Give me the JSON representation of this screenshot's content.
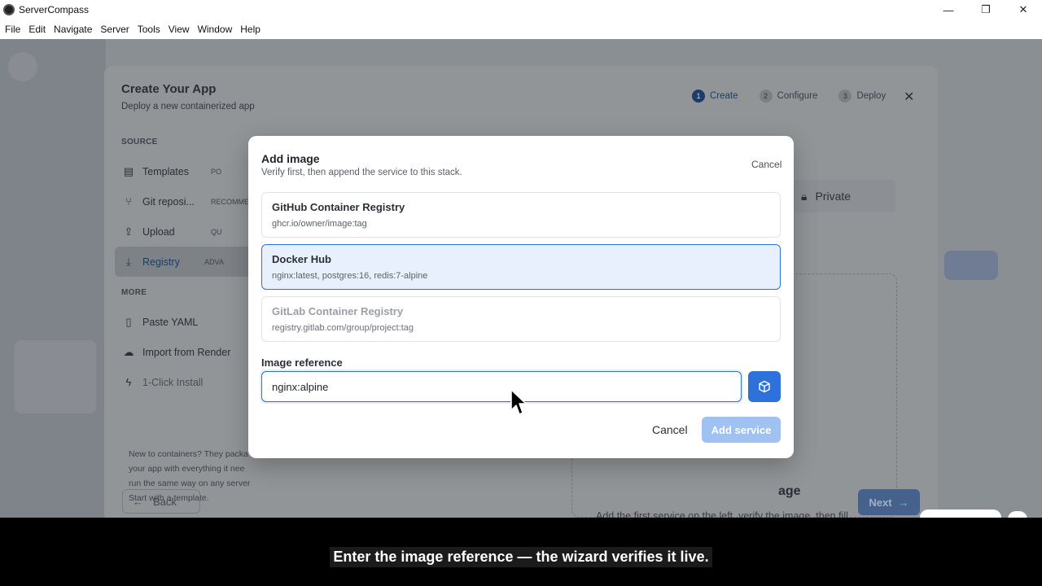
{
  "window": {
    "title": "ServerCompass",
    "minimize": "—",
    "restore": "❐",
    "close": "✕"
  },
  "menu": [
    "File",
    "Edit",
    "Navigate",
    "Server",
    "Tools",
    "View",
    "Window",
    "Help"
  ],
  "wizard": {
    "title": "Create Your App",
    "subtitle": "Deploy a new containerized app",
    "steps": [
      {
        "num": "1",
        "label": "Create"
      },
      {
        "num": "2",
        "label": "Configure"
      },
      {
        "num": "3",
        "label": "Deploy"
      }
    ],
    "close": "✕",
    "source_heading": "SOURCE",
    "source_items": [
      {
        "label": "Templates",
        "badge": "PO",
        "icon": "templates-icon"
      },
      {
        "label": "Git reposi...",
        "badge": "RECOMME",
        "icon": "git-icon"
      },
      {
        "label": "Upload",
        "badge": "QU",
        "icon": "upload-icon"
      },
      {
        "label": "Registry",
        "badge": "ADVA",
        "icon": "registry-icon"
      }
    ],
    "more_heading": "MORE",
    "more_items": [
      {
        "label": "Paste YAML",
        "icon": "document-icon"
      },
      {
        "label": "Import from Render",
        "icon": "cloud-icon"
      },
      {
        "label": "1-Click Install",
        "icon": "bolt-icon"
      }
    ],
    "help_text": [
      "New to containers? They packa",
      "your app with everything it nee",
      "run the same way on any server",
      "Start with a template."
    ],
    "back": "Back",
    "next": "Next",
    "private": "Private",
    "empty_title": "age",
    "empty_desc": "Add the first service on the left, verify the image, then fill"
  },
  "dialog": {
    "title": "Add image",
    "subtitle": "Verify first, then append the service to this stack.",
    "cancel_top": "Cancel",
    "registries": [
      {
        "name": "GitHub Container Registry",
        "hint": "ghcr.io/owner/image:tag"
      },
      {
        "name": "Docker Hub",
        "hint": "nginx:latest, postgres:16, redis:7-alpine"
      },
      {
        "name": "GitLab Container Registry",
        "hint": "registry.gitlab.com/group/project:tag"
      }
    ],
    "image_label": "Image reference",
    "image_value": "nginx:alpine",
    "cancel": "Cancel",
    "add_service": "Add service"
  },
  "caption": "Enter the image reference — the wizard verifies it live.",
  "colors": {
    "accent": "#2c72da",
    "selected_bg": "#e7f0fc",
    "overlay": "#8a8f94"
  }
}
